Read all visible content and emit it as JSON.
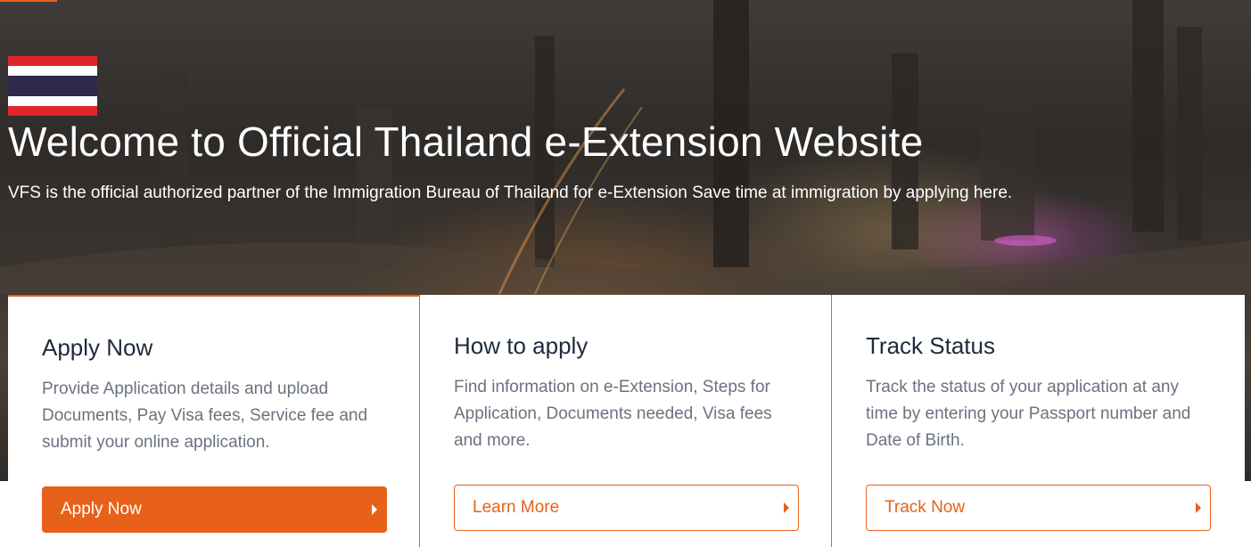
{
  "hero": {
    "title": "Welcome to Official Thailand e-Extension Website",
    "subtitle": "VFS is the official authorized partner of the Immigration Bureau of Thailand for e-Extension Save time at immigration by applying here."
  },
  "colors": {
    "accent": "#e8611a",
    "heading": "#1e2a3c",
    "body_text": "#6b7280"
  },
  "cards": [
    {
      "title": "Apply Now",
      "description": "Provide Application details and upload Documents, Pay Visa fees, Service fee and submit your online application.",
      "button_label": "Apply Now",
      "button_style": "solid",
      "button_icon": "chevron-right-icon"
    },
    {
      "title": "How to apply",
      "description": "Find information on e-Extension, Steps for Application, Documents needed, Visa fees and more.",
      "button_label": "Learn More",
      "button_style": "outline",
      "button_icon": "chevron-right-icon"
    },
    {
      "title": "Track Status",
      "description": "Track the status of your application at any time by entering your Passport number and Date of Birth.",
      "button_label": "Track Now",
      "button_style": "outline",
      "button_icon": "chevron-right-icon"
    }
  ]
}
